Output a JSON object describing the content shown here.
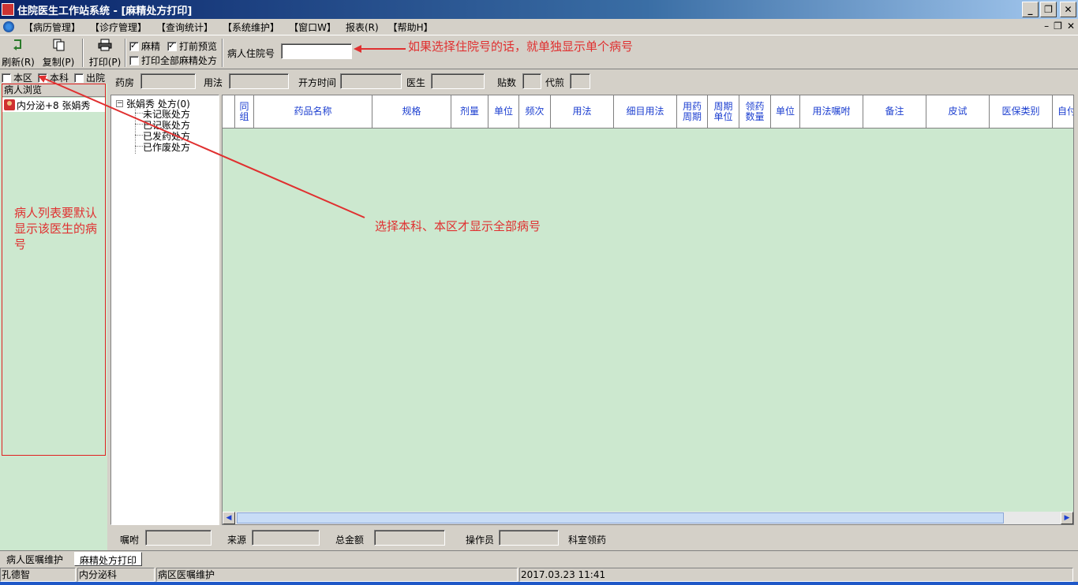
{
  "window": {
    "title": "住院医生工作站系统 - [麻精处方打印]"
  },
  "menu": {
    "items": [
      "【病历管理】",
      "【诊疗管理】",
      "【查询统计】",
      "【系统维护】",
      "【窗口W】",
      "报表(R)",
      "【帮助H】"
    ]
  },
  "toolbar": {
    "refresh_label": "刷新(R)",
    "copy_label": "复制(P)",
    "print_label": "打印(P)",
    "cb_mazhao": "麻精",
    "cb_preview": "打前预览",
    "cb_print_all": "打印全部麻精处方",
    "patient_no_label": "病人住院号",
    "patient_no_value": ""
  },
  "left_filters": {
    "area": "本区",
    "dept": "本科",
    "discharged": "出院"
  },
  "patient_list": {
    "header": "病人浏览",
    "items": [
      {
        "label": "内分泌+8 张娟秀"
      }
    ]
  },
  "filter_row": {
    "pharmacy": "药房",
    "usage": "用法",
    "rx_time": "开方时间",
    "doctor": "医生",
    "doses": "贴数",
    "decoct": "代煎"
  },
  "tree": {
    "root": "张娟秀 处方(0)",
    "children": [
      "未记账处方",
      "已记账处方",
      "已发药处方",
      "已作废处方"
    ]
  },
  "grid": {
    "columns": [
      "同组",
      "药品名称",
      "规格",
      "剂量",
      "单位",
      "频次",
      "用法",
      "细目用法",
      "用药周期",
      "周期单位",
      "领药数量",
      "单位",
      "用法嘱咐",
      "备注",
      "皮试",
      "医保类别",
      "自付"
    ]
  },
  "bottom_row": {
    "advice": "嘱咐",
    "source": "来源",
    "total": "总金额",
    "operator": "操作员",
    "ward_pickup": "科室领药"
  },
  "tabs": [
    "病人医嘱维护",
    "麻精处方打印"
  ],
  "status": {
    "user": "孔德智",
    "dept": "内分泌科",
    "module": "病区医嘱维护",
    "datetime": "2017.03.23 11:41"
  },
  "annotations": {
    "top": "如果选择住院号的话，就单独显示单个病号",
    "middle": "选择本科、本区才显示全部病号",
    "left": "病人列表要默认显示该医生的病号"
  },
  "colors": {
    "grid_bg": "#cce8cf",
    "header_text": "#1c3fd0",
    "annotation": "#e03030",
    "title_bar": "#0a246a"
  }
}
